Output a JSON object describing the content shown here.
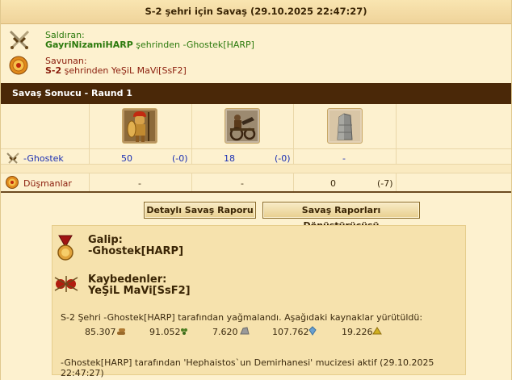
{
  "report": {
    "title": "S-2 şehri için Savaş (29.10.2025 22:47:27)"
  },
  "attacker": {
    "label": "Saldıran:",
    "player": "GayriNizamiHARP",
    "from_text": " şehrinden ",
    "city": "-Ghostek[HARP]"
  },
  "defender": {
    "label": "Savunan:",
    "city": "S-2",
    "from_text": " şehrinden ",
    "player": "YeŞiL MaVi[SsF2]"
  },
  "round_bar": {
    "label": "Savaş Sonucu - Raund 1"
  },
  "units": [
    {
      "name": "hoplite-unit"
    },
    {
      "name": "chariot-unit"
    },
    {
      "name": "wall-unit"
    }
  ],
  "rows": [
    {
      "name": "-Ghostek",
      "cells": [
        {
          "count": "50",
          "loss": "(-0)"
        },
        {
          "count": "18",
          "loss": "(-0)"
        },
        {
          "count": "-",
          "loss": ""
        }
      ]
    },
    {
      "name": "Düşmanlar",
      "cells": [
        {
          "count": "-",
          "loss": ""
        },
        {
          "count": "-",
          "loss": ""
        },
        {
          "count": "0",
          "loss": "(-7)"
        }
      ]
    }
  ],
  "buttons": {
    "detailed": "Detaylı Savaş Raporu",
    "converter": "Savaş Raporları Dönüştürücüsü"
  },
  "result": {
    "winner_label": "Galip:",
    "winner": "-Ghostek[HARP]",
    "loser_label": "Kaybedenler:",
    "loser": "YeŞiL MaVi[SsF2]",
    "loot_text": "S-2 Şehri -Ghostek[HARP] tarafından yağmalandı. Aşağıdaki kaynaklar yürütüldü:",
    "resources": [
      {
        "amount": "85.307",
        "icon": "wood-icon",
        "color": "#9a6a2a"
      },
      {
        "amount": "91.052",
        "icon": "wine-icon",
        "color": "#4c7d20"
      },
      {
        "amount": "7.620",
        "icon": "marble-icon",
        "color": "#9a9a9a"
      },
      {
        "amount": "107.762",
        "icon": "crystal-icon",
        "color": "#6aa0d0"
      },
      {
        "amount": "19.226",
        "icon": "sulfur-icon",
        "color": "#d0b020"
      }
    ],
    "wonder_text": "-Ghostek[HARP] tarafından 'Hephaistos`un Demirhanesi' mucizesi aktif (29.10.2025 22:47:27)"
  },
  "colors": {
    "background": "#fdf1cf",
    "dark_bar": "#4a2808",
    "number_blue": "#1a2fb3",
    "attacker_green": "#2c7a0d",
    "defender_red": "#8a1c0b"
  }
}
